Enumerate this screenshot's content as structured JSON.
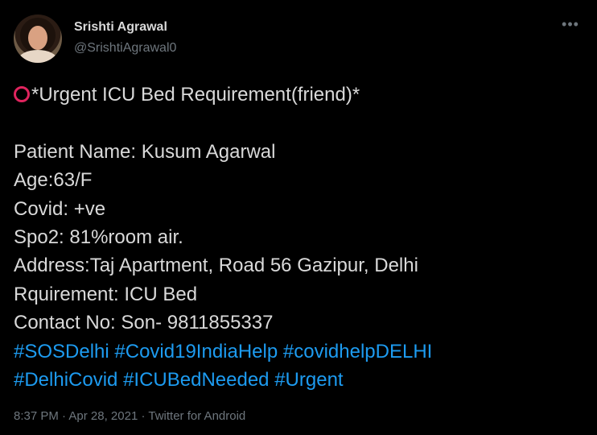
{
  "author": {
    "name": "Srishti Agrawal",
    "handle": "@SrishtiAgrawal0"
  },
  "tweet": {
    "headline": "*Urgent ICU Bed Requirement(friend)*",
    "lines": [
      "Patient Name: Kusum Agarwal",
      "Age:63/F",
      "Covid: +ve",
      "Spo2: 81%room air.",
      "Address:Taj Apartment, Road 56 Gazipur, Delhi",
      "Rquirement: ICU Bed",
      "Contact No: Son- 9811855337"
    ],
    "hashtags_row1": [
      "#SOSDelhi",
      "#Covid19IndiaHelp",
      "#covidhelpDELHI"
    ],
    "hashtags_row2": [
      "#DelhiCovid",
      "#ICUBedNeeded",
      "#Urgent"
    ]
  },
  "meta": {
    "time": "8:37 PM",
    "separator": "·",
    "date": "Apr 28, 2021",
    "source": "Twitter for Android"
  },
  "icons": {
    "more": "more-options-icon",
    "headline_emoji": "hollow-red-circle-icon"
  },
  "colors": {
    "background": "#000000",
    "text": "#d9d9d9",
    "muted": "#6e767d",
    "link": "#1d9bf0",
    "circle": "#e0245e"
  }
}
